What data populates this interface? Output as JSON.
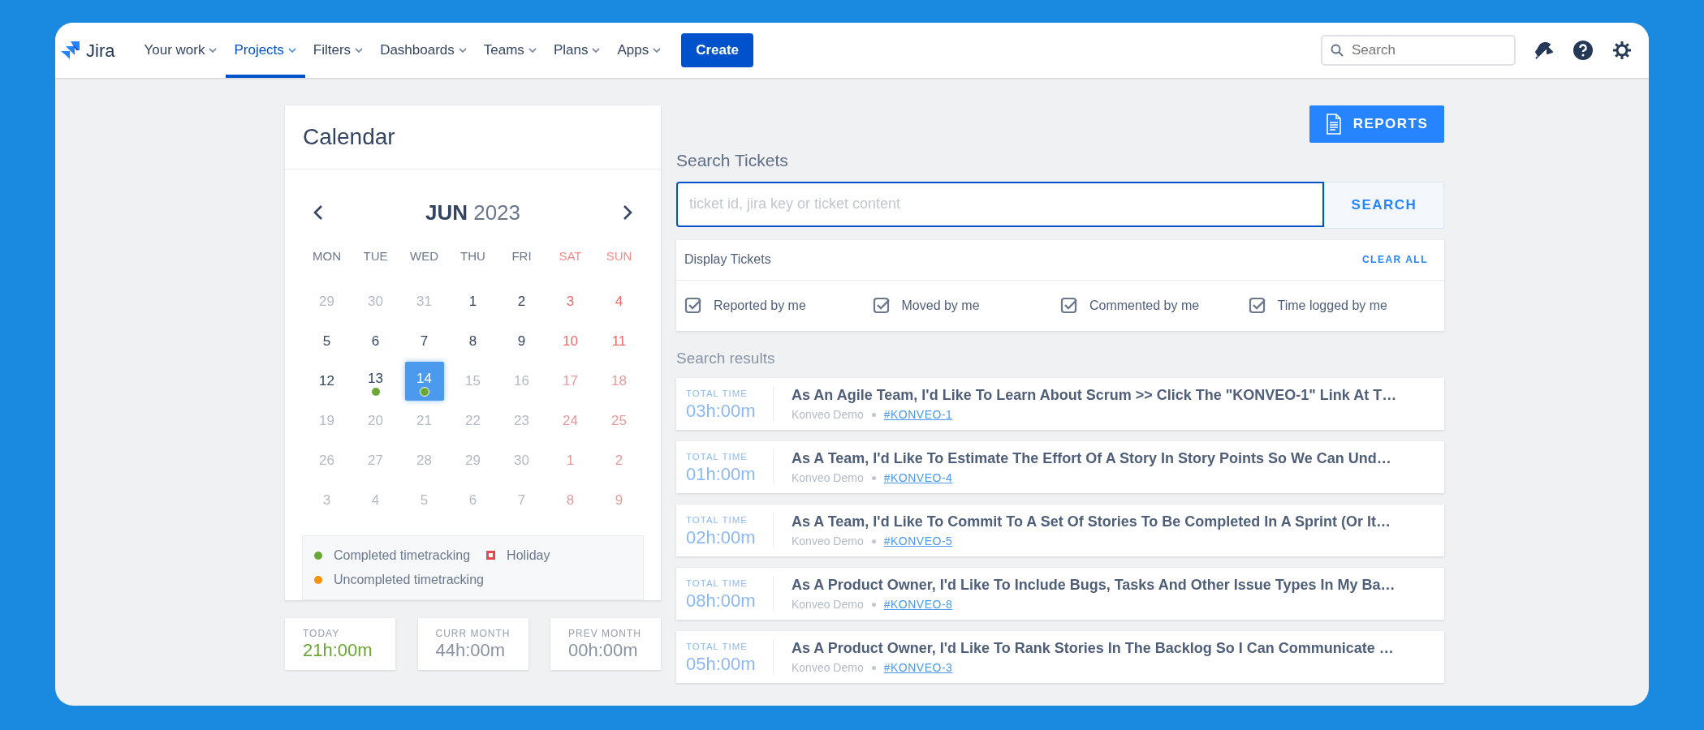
{
  "nav": {
    "logo": "Jira",
    "items": [
      {
        "label": "Your work",
        "selected": false
      },
      {
        "label": "Projects",
        "selected": true
      },
      {
        "label": "Filters",
        "selected": false
      },
      {
        "label": "Dashboards",
        "selected": false
      },
      {
        "label": "Teams",
        "selected": false
      },
      {
        "label": "Plans",
        "selected": false
      },
      {
        "label": "Apps",
        "selected": false
      }
    ],
    "create": "Create",
    "search": {
      "placeholder": "Search"
    }
  },
  "calendar": {
    "title": "Calendar",
    "month": "JUN",
    "year": "2023",
    "weekdays": [
      {
        "label": "MON",
        "weekend": false
      },
      {
        "label": "TUE",
        "weekend": false
      },
      {
        "label": "WED",
        "weekend": false
      },
      {
        "label": "THU",
        "weekend": false
      },
      {
        "label": "FRI",
        "weekend": false
      },
      {
        "label": "SAT",
        "weekend": true
      },
      {
        "label": "SUN",
        "weekend": true
      }
    ],
    "weeks": [
      [
        {
          "day": "29",
          "muted": true,
          "selected": false
        },
        {
          "day": "30",
          "muted": true,
          "selected": false
        },
        {
          "day": "31",
          "muted": true,
          "selected": false
        },
        {
          "day": "1",
          "muted": false,
          "selected": false
        },
        {
          "day": "2",
          "muted": false,
          "selected": false
        },
        {
          "day": "3",
          "muted": false,
          "selected": false
        },
        {
          "day": "4",
          "muted": false,
          "selected": false
        }
      ],
      [
        {
          "day": "5",
          "muted": false,
          "selected": false
        },
        {
          "day": "6",
          "muted": false,
          "selected": false
        },
        {
          "day": "7",
          "muted": false,
          "selected": false
        },
        {
          "day": "8",
          "muted": false,
          "selected": false
        },
        {
          "day": "9",
          "muted": false,
          "selected": false
        },
        {
          "day": "10",
          "muted": false,
          "selected": false
        },
        {
          "day": "11",
          "muted": false,
          "selected": false
        }
      ],
      [
        {
          "day": "12",
          "muted": false,
          "selected": false
        },
        {
          "day": "13",
          "muted": false,
          "selected": false,
          "color": "#6aa834"
        },
        {
          "day": "14",
          "muted": false,
          "selected": true,
          "color": "#6aa834"
        },
        {
          "day": "15",
          "muted": true,
          "selected": false
        },
        {
          "day": "16",
          "muted": true,
          "selected": false
        },
        {
          "day": "17",
          "muted": true,
          "selected": false
        },
        {
          "day": "18",
          "muted": true,
          "selected": false
        }
      ],
      [
        {
          "day": "19",
          "muted": true,
          "selected": false
        },
        {
          "day": "20",
          "muted": true,
          "selected": false
        },
        {
          "day": "21",
          "muted": true,
          "selected": false
        },
        {
          "day": "22",
          "muted": true,
          "selected": false
        },
        {
          "day": "23",
          "muted": true,
          "selected": false
        },
        {
          "day": "24",
          "muted": true,
          "selected": false
        },
        {
          "day": "25",
          "muted": true,
          "selected": false
        }
      ],
      [
        {
          "day": "26",
          "muted": true,
          "selected": false
        },
        {
          "day": "27",
          "muted": true,
          "selected": false
        },
        {
          "day": "28",
          "muted": true,
          "selected": false
        },
        {
          "day": "29",
          "muted": true,
          "selected": false
        },
        {
          "day": "30",
          "muted": true,
          "selected": false
        },
        {
          "day": "1",
          "muted": true,
          "selected": false
        },
        {
          "day": "2",
          "muted": true,
          "selected": false
        }
      ],
      [
        {
          "day": "3",
          "muted": true,
          "selected": false
        },
        {
          "day": "4",
          "muted": true,
          "selected": false
        },
        {
          "day": "5",
          "muted": true,
          "selected": false
        },
        {
          "day": "6",
          "muted": true,
          "selected": false
        },
        {
          "day": "7",
          "muted": true,
          "selected": false
        },
        {
          "day": "8",
          "muted": true,
          "selected": false
        },
        {
          "day": "9",
          "muted": true,
          "selected": false
        }
      ]
    ],
    "legend": [
      {
        "label": "Completed timetracking",
        "kind": "dot",
        "color": "#6aa834"
      },
      {
        "label": "Holiday",
        "kind": "square",
        "color": "#e5484d"
      },
      {
        "label": "Uncompleted timetracking",
        "kind": "dot",
        "color": "#f5930b"
      }
    ]
  },
  "stats": [
    {
      "label": "TODAY",
      "value": "21h:00m",
      "color": "#6aa834"
    },
    {
      "label": "CURR MONTH",
      "value": "44h:00m",
      "color": "#8993a4"
    },
    {
      "label": "PREV MONTH",
      "value": "00h:00m",
      "color": "#8993a4"
    }
  ],
  "reports": "REPORTS",
  "search": {
    "title": "Search Tickets",
    "placeholder": "ticket id, jira key or ticket content",
    "button": "SEARCH"
  },
  "filters": {
    "title": "Display Tickets",
    "clear": "CLEAR ALL",
    "options": [
      {
        "label": "Reported by me",
        "checked": true
      },
      {
        "label": "Moved by me",
        "checked": true
      },
      {
        "label": "Commented by me",
        "checked": true
      },
      {
        "label": "Time logged by me",
        "checked": true
      }
    ]
  },
  "results": {
    "title": "Search results",
    "items": [
      {
        "time_label": "TOTAL TIME",
        "time": "03h:00m",
        "title": "As An Agile Team, I'd Like To Learn About Scrum >> Click The \"KONVEO-1\" Link At T…",
        "project": "Konveo Demo",
        "key": "#KONVEO-1"
      },
      {
        "time_label": "TOTAL TIME",
        "time": "01h:00m",
        "title": "As A Team, I'd Like To Estimate The Effort Of A Story In Story Points So We Can Und…",
        "project": "Konveo Demo",
        "key": "#KONVEO-4"
      },
      {
        "time_label": "TOTAL TIME",
        "time": "02h:00m",
        "title": "As A Team, I'd Like To Commit To A Set Of Stories To Be Completed In A Sprint (Or It…",
        "project": "Konveo Demo",
        "key": "#KONVEO-5"
      },
      {
        "time_label": "TOTAL TIME",
        "time": "08h:00m",
        "title": "As A Product Owner, I'd Like To Include Bugs, Tasks And Other Issue Types In My Ba…",
        "project": "Konveo Demo",
        "key": "#KONVEO-8"
      },
      {
        "time_label": "TOTAL TIME",
        "time": "05h:00m",
        "title": "As A Product Owner, I'd Like To Rank Stories In The Backlog So I Can Communicate …",
        "project": "Konveo Demo",
        "key": "#KONVEO-3"
      }
    ]
  }
}
